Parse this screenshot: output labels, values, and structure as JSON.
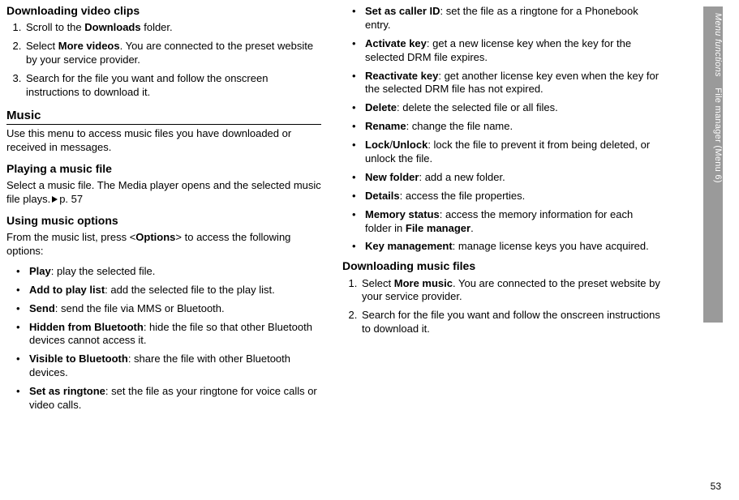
{
  "page_number": "53",
  "sidebar": {
    "section": "Menu functions",
    "sub": "File manager (Menu 6)"
  },
  "left": {
    "h_download_video": "Downloading video clips",
    "video_steps": [
      {
        "pre": "Scroll to the ",
        "b1": "Downloads",
        "post": " folder."
      },
      {
        "pre": "Select ",
        "b1": "More videos",
        "post": ". You are connected to the preset website by your service provider."
      },
      {
        "pre": "Search for the file you want and follow the onscreen instructions to download it."
      }
    ],
    "h_music": "Music",
    "music_intro": "Use this menu to access music files you have downloaded or received in messages.",
    "h_play_file": "Playing a music file",
    "play_file_text_pre": "Select a music file. The Media player opens and the selected music file plays.",
    "play_file_ref": "p. 57",
    "h_using_opts": "Using music options",
    "using_opts_pre": "From the music list, press <",
    "using_opts_b": "Options",
    "using_opts_post": "> to access the following options:",
    "opts": [
      {
        "b": "Play",
        "t": ": play the selected file."
      },
      {
        "b": "Add to play list",
        "t": ": add the selected file to the play list."
      },
      {
        "b": "Send",
        "t": ": send the file via MMS or Bluetooth."
      },
      {
        "b": "Hidden from Bluetooth",
        "t": ": hide the file so that other Bluetooth devices cannot access it."
      },
      {
        "b": "Visible to Bluetooth",
        "t": ": share the file with other Bluetooth devices."
      },
      {
        "b": "Set as ringtone",
        "t": ": set the file as your ringtone for voice calls or video calls."
      }
    ]
  },
  "right": {
    "opts": [
      {
        "b": "Set as caller ID",
        "t": ": set the file as a ringtone for a Phonebook entry."
      },
      {
        "b": "Activate key",
        "t": ": get a new license key when the key for the selected DRM file expires."
      },
      {
        "b": "Reactivate key",
        "t": ": get another license key even when the key for the selected DRM file has not expired."
      },
      {
        "b": "Delete",
        "t": ": delete the selected file or all files."
      },
      {
        "b": "Rename",
        "t": ": change the file name."
      },
      {
        "b": "Lock",
        "b2": "Unlock",
        "sep": "/",
        "t": ": lock the file to prevent it from being deleted, or unlock the file."
      },
      {
        "b": "New folder",
        "t": ": add a new folder."
      },
      {
        "b": "Details",
        "t": ": access the file properties."
      },
      {
        "b": "Memory status",
        "t_pre": ": access the memory information for each folder in ",
        "t_b": "File manager",
        "t_post": "."
      },
      {
        "b": "Key management",
        "t": ": manage license keys you have acquired."
      }
    ],
    "h_download_music": "Downloading music files",
    "music_steps": [
      {
        "pre": "Select ",
        "b1": "More music",
        "post": ". You are connected to the preset website by your service provider."
      },
      {
        "pre": "Search for the file you want and follow the onscreen instructions to download it."
      }
    ]
  }
}
